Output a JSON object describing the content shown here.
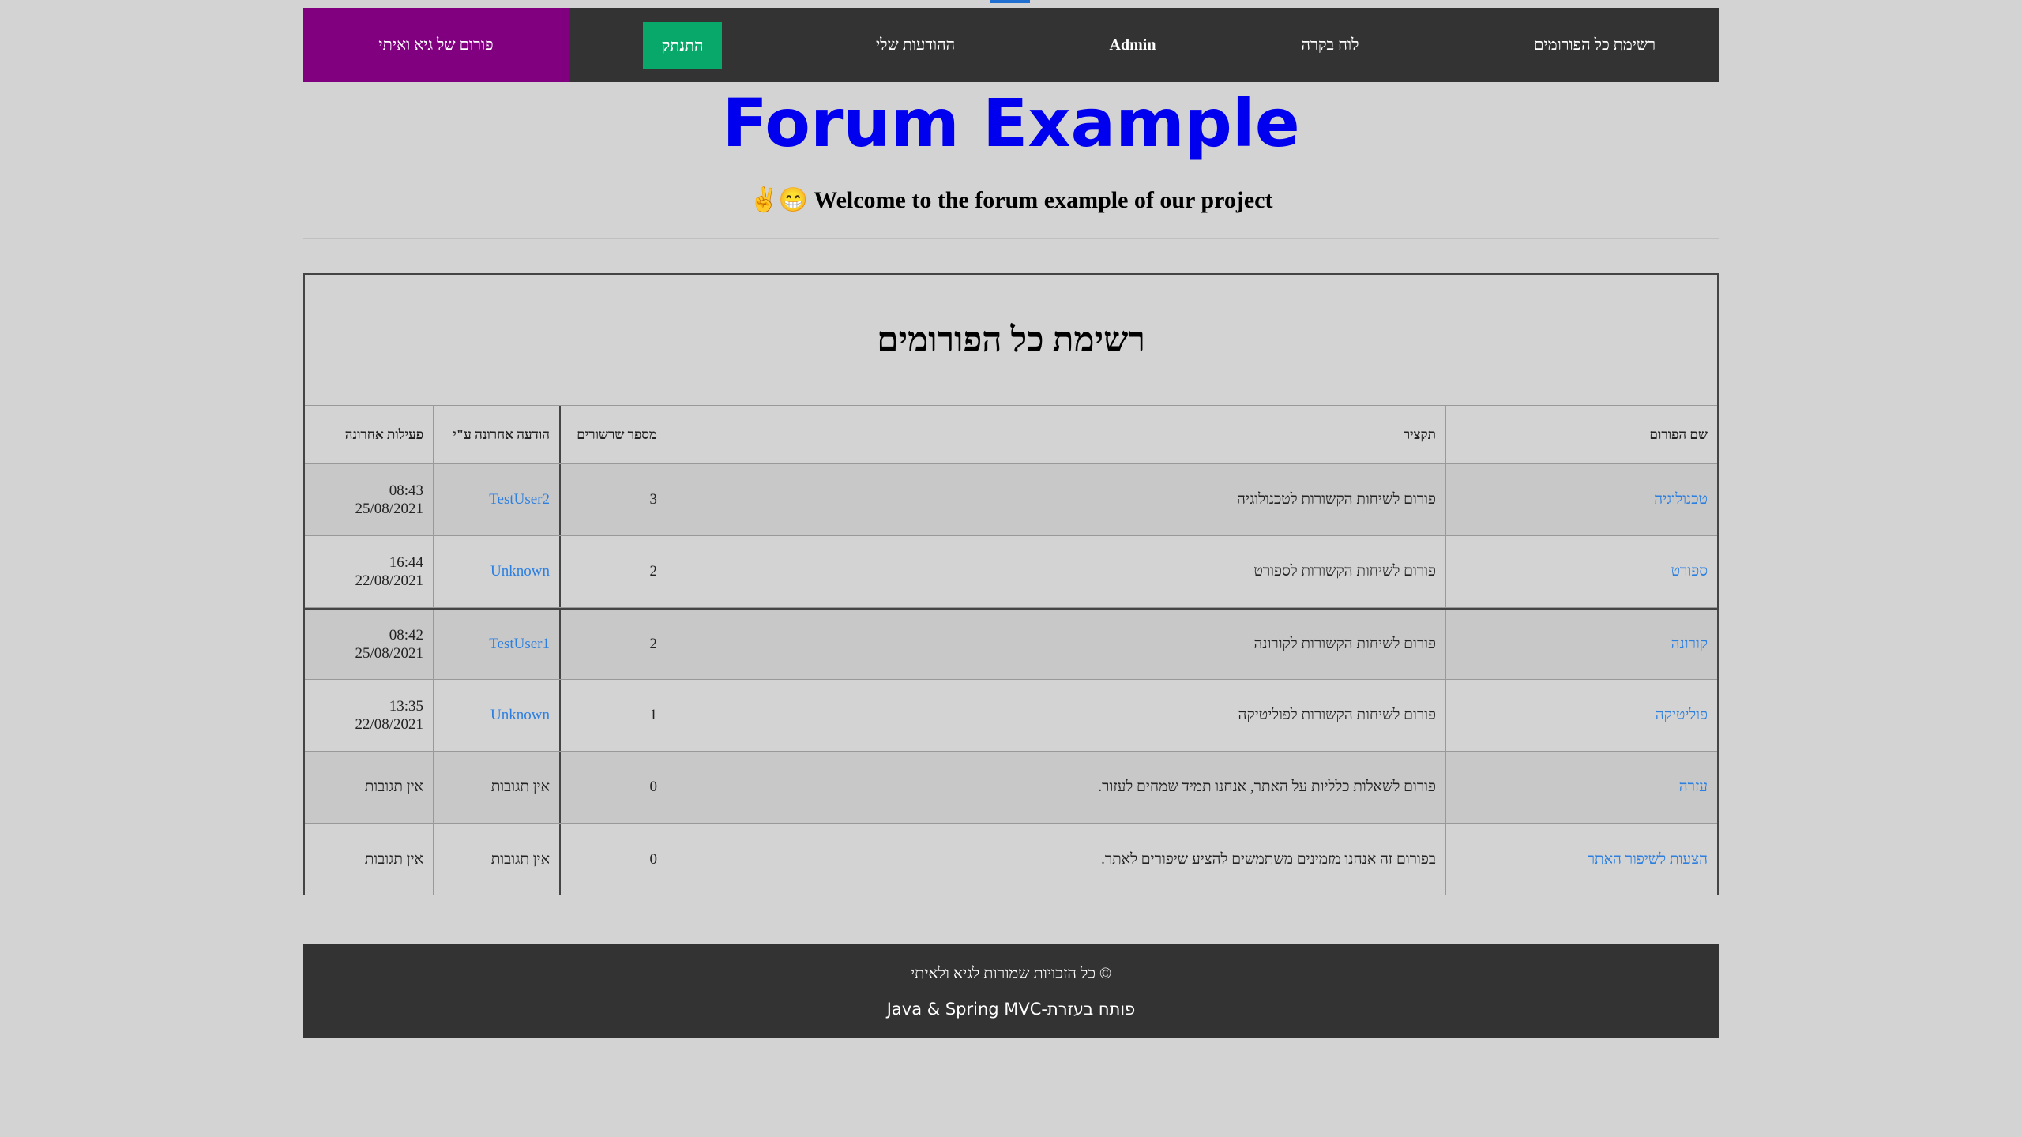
{
  "nav": {
    "brand": "פורום של גיא ואיתי",
    "logout_label": "התנתק",
    "my_posts_label": "ההודעות שלי",
    "user_label": "Admin",
    "dashboard_label": "לוח בקרה",
    "all_forums_label": "רשימת כל הפורומים",
    "brand_color": "#800080",
    "logout_color": "#07a86a"
  },
  "header": {
    "site_title": "Forum Example",
    "welcome_text": "Welcome to the forum example of our project",
    "welcome_emoji": "✌😁",
    "title_color": "#0000ee"
  },
  "table": {
    "caption": "רשימת כל הפורומים",
    "columns": {
      "name": "שם הפורום",
      "description": "תקציר",
      "subscribers": "מספר שרשורים",
      "last_by": "הודעה אחרונה ע\"י",
      "last_activity": "פעילות אחרונה"
    },
    "rows": [
      {
        "name": "טכנולוגיה",
        "description": "פורום לשיחות הקשורות לטכנולוגיה",
        "threads": "3",
        "last_by": "TestUser2",
        "last_time": "08:43",
        "last_date": "25/08/2021"
      },
      {
        "name": "ספורט",
        "description": "פורום לשיחות הקשורות לספורט",
        "threads": "2",
        "last_by": "Unknown",
        "last_time": "16:44",
        "last_date": "22/08/2021"
      },
      {
        "name": "קורונה",
        "description": "פורום לשיחות הקשורות לקורונה",
        "threads": "2",
        "last_by": "TestUser1",
        "last_time": "08:42",
        "last_date": "25/08/2021"
      },
      {
        "name": "פוליטיקה",
        "description": "פורום לשיחות הקשורות לפוליטיקה",
        "threads": "1",
        "last_by": "Unknown",
        "last_time": "13:35",
        "last_date": "22/08/2021"
      },
      {
        "name": "עזרה",
        "description": "פורום לשאלות כלליות על האתר, אנחנו תמיד שמחים לעזור.",
        "threads": "0",
        "last_by_text": "אין תגובות",
        "last_activity_text": "אין תגובות"
      },
      {
        "name": "הצעות לשיפור האתר",
        "description": "בפורום זה אנחנו מזמינים משתמשים להציע שיפורים לאתר.",
        "threads": "0",
        "last_by_text": "אין תגובות",
        "last_activity_text": "אין תגובות"
      }
    ]
  },
  "footer": {
    "copyright": "© כל הזכויות שמורות לגיא ולאיתי",
    "credit": "פותח בעזרת-Java & Spring MVC"
  }
}
